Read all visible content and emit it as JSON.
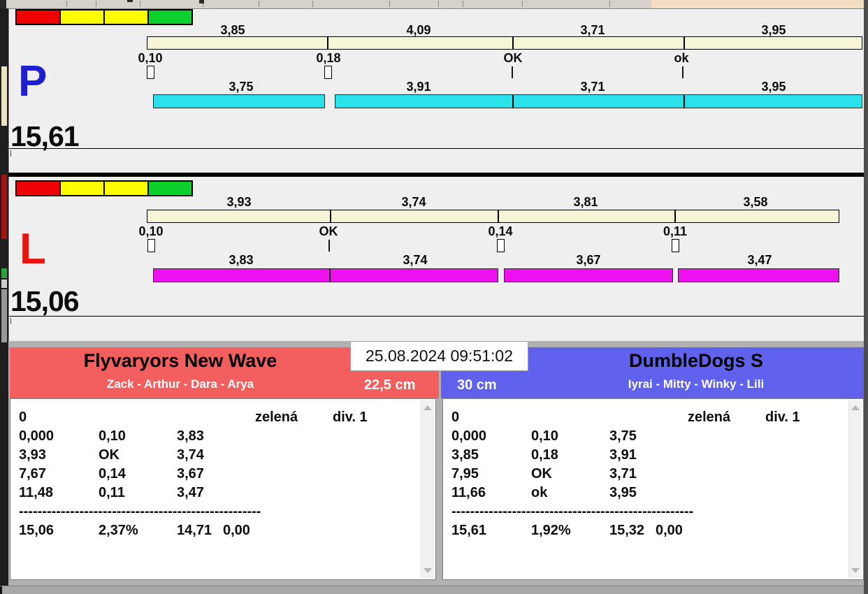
{
  "scoreboard": {
    "timestamp": "25.08.2024 09:51:02"
  },
  "lanes": [
    {
      "label": "P",
      "total": "15,61",
      "lights": [
        "red",
        "yellow",
        "yellow",
        "green"
      ],
      "splits_top": [
        "3,85",
        "4,09",
        "3,71",
        "3,95"
      ],
      "faults": [
        "0,10",
        "0,18",
        "OK",
        "ok"
      ],
      "splits_bottom": [
        "3,75",
        "3,91",
        "3,71",
        "3,95"
      ]
    },
    {
      "label": "L",
      "total": "15,06",
      "lights": [
        "red",
        "yellow",
        "yellow",
        "green"
      ],
      "splits_top": [
        "3,93",
        "3,74",
        "3,81",
        "3,58"
      ],
      "faults": [
        "0,10",
        "OK",
        "0,14",
        "0,11"
      ],
      "splits_bottom": [
        "3,83",
        "3,74",
        "3,67",
        "3,47"
      ]
    }
  ],
  "teams": [
    {
      "name": "Flyvaryors New Wave",
      "dogs": "Zack - Arthur - Dara - Arya",
      "jump_height": "22,5 cm",
      "result": {
        "status": {
          "run": "0",
          "light": "zelená",
          "division": "div. 1"
        },
        "legs": [
          {
            "cum": "0,000",
            "fault": "0,10",
            "split": "3,83"
          },
          {
            "cum": "3,93",
            "fault": "OK",
            "split": "3,74"
          },
          {
            "cum": "7,67",
            "fault": "0,14",
            "split": "3,67"
          },
          {
            "cum": "11,48",
            "fault": "0,11",
            "split": "3,47"
          }
        ],
        "separator": "----------------------------------------------------",
        "totals": {
          "time": "15,06",
          "percent": "2,37%",
          "net": "14,71",
          "penalty": "0,00"
        }
      }
    },
    {
      "name": "DumbleDogs S",
      "dogs": "Iyrai - Mitty - Winky - Lili",
      "jump_height": "30 cm",
      "result": {
        "status": {
          "run": "0",
          "light": "zelená",
          "division": "div. 1"
        },
        "legs": [
          {
            "cum": "0,000",
            "fault": "0,10",
            "split": "3,75"
          },
          {
            "cum": "3,85",
            "fault": "0,18",
            "split": "3,91"
          },
          {
            "cum": "7,95",
            "fault": "OK",
            "split": "3,71"
          },
          {
            "cum": "11,66",
            "fault": "ok",
            "split": "3,95"
          }
        ],
        "separator": "----------------------------------------------------",
        "totals": {
          "time": "15,61",
          "percent": "1,92%",
          "net": "15,32",
          "penalty": "0,00"
        }
      }
    }
  ],
  "colors": {
    "lane_p_letter": "#1f1fd0",
    "lane_l_letter": "#e8150f",
    "p_run_bar": "#29e1e9",
    "l_run_bar": "#ee10ee",
    "interval_bar": "#f8f5d7",
    "team1_header": "#f25f5e",
    "team2_header": "#6062ee",
    "light_red": "#ee0202",
    "light_yellow": "#fdfd02",
    "light_green": "#0ad22a"
  }
}
